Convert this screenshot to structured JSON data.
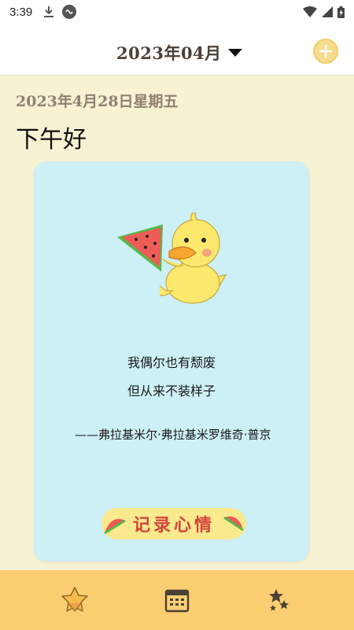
{
  "status_bar": {
    "time": "3:39",
    "icons": [
      "download-icon",
      "sync-icon",
      "wifi-icon",
      "signal-icon",
      "battery-icon"
    ]
  },
  "header": {
    "month_label": "2023年04月",
    "dropdown_icon": "triangle-down-icon",
    "add_icon": "plus-circle-icon"
  },
  "date_line": "2023年4月28日星期五",
  "greeting": "下午好",
  "card": {
    "illustration": "duck-eating-watermelon",
    "quote_lines": [
      "我偶尔也有颓废",
      "但从来不装样子"
    ],
    "author": "——弗拉基米尔·弗拉基米罗维奇·普京",
    "button_label": "记录心情"
  },
  "bottom_nav": {
    "items": [
      {
        "name": "home",
        "icon": "star-badge-icon"
      },
      {
        "name": "calendar",
        "icon": "calendar-icon"
      },
      {
        "name": "collection",
        "icon": "stars-icon"
      }
    ]
  },
  "colors": {
    "background": "#f8f2d4",
    "card": "#cdeff6",
    "nav": "#fcce72",
    "accent_red": "#d4453d"
  }
}
